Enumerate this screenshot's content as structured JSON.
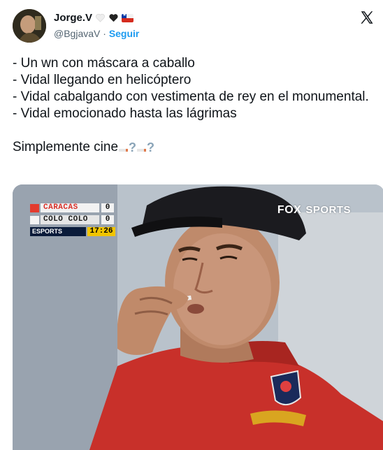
{
  "author": {
    "display_name": "Jorge.V",
    "handle": "@BgjavaV",
    "separator": "·",
    "follow_label": "Seguir",
    "emoji": [
      "white-heart",
      "black-heart",
      "chile-flag"
    ]
  },
  "tweet": {
    "lines": [
      "- Un wn con máscara a caballo",
      "- Vidal llegando en helicóptero",
      "- Vidal cabalgando con vestimenta de rey en el monumental.",
      "- Vidal emocionado hasta las lágrimas"
    ],
    "closing": "Simplemente cine",
    "closing_emoji": [
      "cigarette",
      "question-mark",
      "cigarette",
      "question-mark"
    ]
  },
  "media": {
    "scoreboard": {
      "team1": "CARACAS",
      "team1_score": "0",
      "team2": "COLO COLO",
      "team2_score": "0",
      "network": "ESPORTS",
      "time": "17:26"
    },
    "watermark": "FOX SPORTS",
    "watermark_parts": [
      "FOX",
      "SPORTS"
    ]
  },
  "colors": {
    "link": "#1d9bf0",
    "muted": "#536471",
    "text": "#0f1419",
    "shirt": "#c8302a"
  }
}
